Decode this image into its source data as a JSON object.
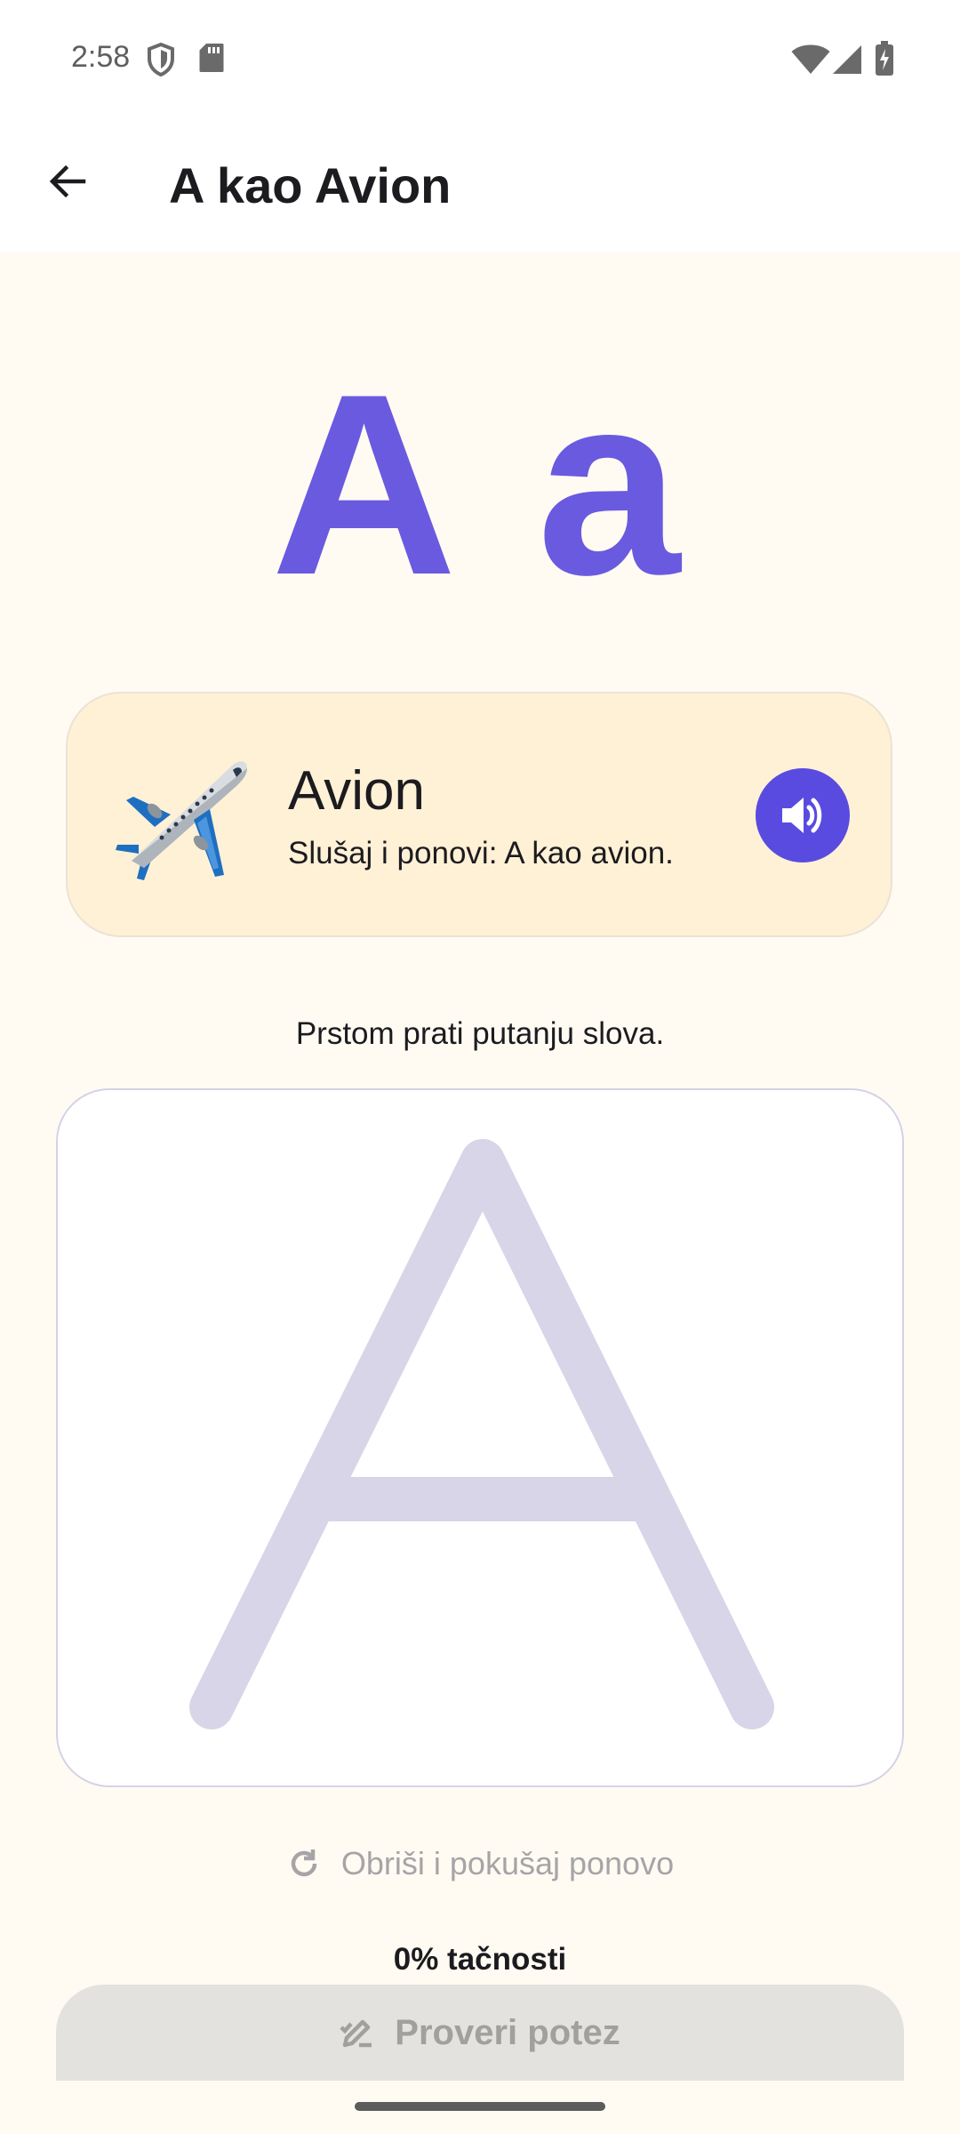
{
  "status_bar": {
    "time": "2:58",
    "icons": [
      "shield-icon",
      "sd-card-icon",
      "wifi-icon",
      "signal-icon",
      "battery-charging-icon"
    ]
  },
  "header": {
    "title": "A kao Avion",
    "back_icon": "arrow-left-icon"
  },
  "letter": {
    "upper": "A",
    "lower": "a",
    "color": "#6A5AE0"
  },
  "word_card": {
    "emoji": "airplane",
    "word": "Avion",
    "subtitle": "Slušaj i ponovi: A kao avion.",
    "speaker_icon": "volume-icon"
  },
  "instruction": "Prstom prati putanju slova.",
  "clear_button": {
    "label": "Obriši i pokušaj ponovo",
    "icon": "refresh-icon"
  },
  "accuracy": "0% tačnosti",
  "check_button": {
    "label": "Proveri potez",
    "icon": "pencil-check-icon"
  },
  "colors": {
    "accent": "#5A4BE0",
    "background": "#FFFBF3",
    "card": "#FFF1D6",
    "trace_guide": "#D8D5E8"
  }
}
